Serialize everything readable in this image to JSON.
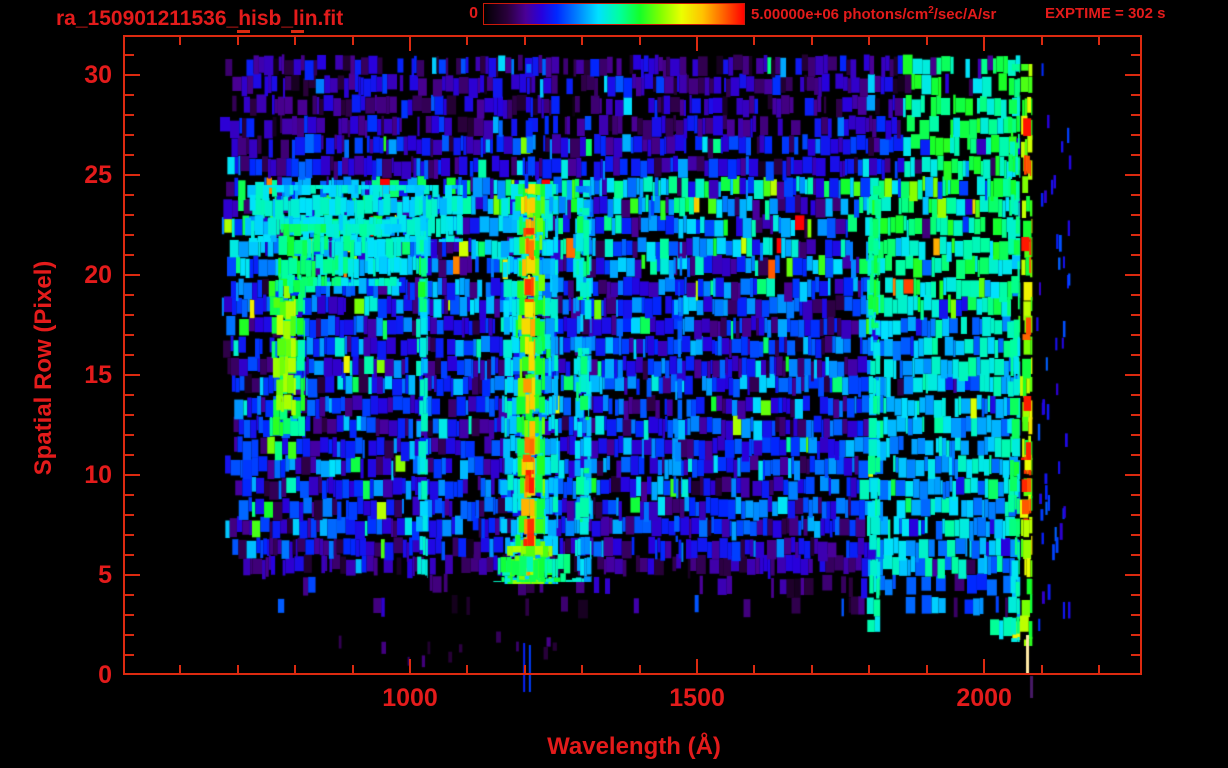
{
  "header": {
    "title": "ra_150901211536_hisb_lin.fit",
    "colorbar": {
      "min_label": "0",
      "max_prefix": "5.00000e+06 photons/cm",
      "max_sup": "2",
      "max_suffix": "/sec/A/sr"
    },
    "exptime": "EXPTIME = 302 s"
  },
  "colors": {
    "background": "#000000",
    "text": "#e31b1b",
    "axis": "#dc2a10",
    "colorbar_border": "#cc1a08"
  },
  "axes": {
    "x_title": "Wavelength (Å)",
    "y_title": "Spatial Row (Pixel)",
    "x_major_ticks": [
      {
        "value": 1000,
        "label": "1000"
      },
      {
        "value": 1500,
        "label": "1500"
      },
      {
        "value": 2000,
        "label": "2000"
      }
    ],
    "x_minor_step": 100,
    "x_minor_range": [
      600,
      2200
    ],
    "y_major_ticks": [
      {
        "value": 0,
        "label": "0"
      },
      {
        "value": 5,
        "label": "5"
      },
      {
        "value": 10,
        "label": "10"
      },
      {
        "value": 15,
        "label": "15"
      },
      {
        "value": 20,
        "label": "20"
      },
      {
        "value": 25,
        "label": "25"
      },
      {
        "value": 30,
        "label": "30"
      }
    ],
    "y_minor_step": 1
  },
  "chart_data": {
    "type": "heatmap",
    "title": "ra_150901211536_hisb_lin.fit",
    "xlabel": "Wavelength (Å)",
    "ylabel": "Spatial Row (Pixel)",
    "xlim": [
      500,
      2275
    ],
    "ylim": [
      0,
      32
    ],
    "colorbar_range": [
      0,
      5000000
    ],
    "colorbar_units": "photons/cm2/sec/A/sr",
    "exposure_s": 302,
    "colormap_stops": [
      [
        0.0,
        0,
        0,
        0
      ],
      [
        0.09,
        42,
        0,
        60
      ],
      [
        0.16,
        74,
        0,
        150
      ],
      [
        0.22,
        40,
        0,
        220
      ],
      [
        0.28,
        0,
        40,
        255
      ],
      [
        0.36,
        0,
        130,
        255
      ],
      [
        0.44,
        0,
        225,
        255
      ],
      [
        0.52,
        0,
        255,
        160
      ],
      [
        0.6,
        20,
        255,
        40
      ],
      [
        0.68,
        130,
        255,
        0
      ],
      [
        0.76,
        235,
        255,
        0
      ],
      [
        0.84,
        255,
        195,
        0
      ],
      [
        0.92,
        255,
        100,
        0
      ],
      [
        1.0,
        255,
        0,
        0
      ]
    ],
    "noise": {
      "seed": 150901211,
      "row_bands": [
        {
          "rows": [
            2,
            2
          ],
          "mean": 0.48,
          "density": 0.8,
          "wl": [
            1988,
            2063
          ]
        },
        {
          "rows": [
            3,
            3
          ],
          "mean": 0.13,
          "density": 0.5,
          "wl": [
            740,
            2063
          ],
          "dense_from": 1770
        },
        {
          "rows": [
            4,
            4
          ],
          "mean": 0.15,
          "density": 0.6,
          "wl": [
            700,
            2063
          ],
          "dense_from": 1640
        },
        {
          "rows": [
            5,
            5
          ],
          "mean": 0.16,
          "density": 0.85,
          "wl": [
            700,
            2063
          ]
        },
        {
          "rows": [
            6,
            6
          ],
          "mean": 0.23,
          "density": 0.92,
          "wl": [
            678,
            2063
          ]
        },
        {
          "rows": [
            7,
            9
          ],
          "mean": 0.27,
          "density": 0.95,
          "wl": [
            678,
            2063
          ]
        },
        {
          "rows": [
            10,
            17
          ],
          "mean": 0.28,
          "density": 0.95,
          "wl": [
            672,
            2063
          ]
        },
        {
          "rows": [
            18,
            19
          ],
          "mean": 0.31,
          "density": 0.95,
          "wl": [
            672,
            2063
          ]
        },
        {
          "rows": [
            20,
            21
          ],
          "mean": 0.38,
          "density": 0.95,
          "wl": [
            672,
            2063
          ]
        },
        {
          "rows": [
            22,
            24
          ],
          "mean": 0.4,
          "density": 0.95,
          "wl": [
            668,
            2063
          ]
        },
        {
          "rows": [
            25,
            26
          ],
          "mean": 0.24,
          "density": 0.9,
          "wl": [
            668,
            2063
          ]
        },
        {
          "rows": [
            27,
            30
          ],
          "mean": 0.18,
          "density": 0.84,
          "wl": [
            668,
            2063
          ]
        }
      ],
      "right_region": {
        "wl": [
          1758,
          2063
        ],
        "upper_from": 1850,
        "v_bright": [
          0.44,
          0.62
        ],
        "v_mid": [
          0.32,
          0.52
        ],
        "v_low": [
          0.27,
          0.43
        ]
      }
    },
    "features": [
      {
        "name": "continuum-top-band",
        "wl": [
          712,
          1092
        ],
        "rows": [
          21.8,
          24.35
        ],
        "v": [
          0.4,
          0.5
        ]
      },
      {
        "name": "aperture-hook-blob",
        "wl": [
          770,
          985
        ],
        "rows": [
          19.6,
          22.4
        ],
        "v": [
          0.5,
          0.62
        ],
        "fade": 1
      },
      {
        "name": "aperture-hook-strip",
        "wl": [
          753,
          817
        ],
        "rows": [
          12.1,
          19.6
        ],
        "v": [
          0.5,
          0.62
        ]
      },
      {
        "name": "aperture-hook-core",
        "wl": [
          760,
          801
        ],
        "rows": [
          13.0,
          18.7
        ],
        "v": [
          0.64,
          0.74
        ]
      },
      {
        "name": "lyman-beta-line",
        "wl": [
          1010,
          1031
        ],
        "rows": [
          5.0,
          24.3
        ],
        "v": [
          0.4,
          0.5
        ]
      },
      {
        "name": "lyman-beta-bright",
        "wl": [
          1012,
          1029
        ],
        "rows": [
          18.3,
          21.6
        ],
        "v": [
          0.52,
          0.62
        ]
      },
      {
        "name": "lyman-alpha-outer",
        "wl": [
          1157,
          1258
        ],
        "rows": [
          4.7,
          24.4
        ],
        "v": [
          0.38,
          0.5
        ]
      },
      {
        "name": "lyman-alpha-mid",
        "wl": [
          1183,
          1235
        ],
        "rows": [
          4.7,
          24.4
        ],
        "v": [
          0.55,
          0.68
        ]
      },
      {
        "name": "lyman-alpha-core",
        "wl": [
          1193,
          1218
        ],
        "rows": [
          4.7,
          24.4
        ],
        "v": [
          0.78,
          0.88
        ]
      },
      {
        "name": "lyman-alpha-red-1",
        "wl": [
          1196,
          1216
        ],
        "rows": [
          6.4,
          7.7
        ],
        "v": [
          0.9,
          0.98
        ]
      },
      {
        "name": "lyman-alpha-red-2",
        "wl": [
          1196,
          1216
        ],
        "rows": [
          9.2,
          10.1
        ],
        "v": [
          0.9,
          0.98
        ]
      },
      {
        "name": "lyman-alpha-red-3",
        "wl": [
          1196,
          1216
        ],
        "rows": [
          10.8,
          11.9
        ],
        "v": [
          0.9,
          0.98
        ]
      },
      {
        "name": "lyman-alpha-red-4",
        "wl": [
          1196,
          1216
        ],
        "rows": [
          18.8,
          19.9
        ],
        "v": [
          0.9,
          0.98
        ]
      },
      {
        "name": "lyman-alpha-red-5",
        "wl": [
          1196,
          1216
        ],
        "rows": [
          20.9,
          22.2
        ],
        "v": [
          0.9,
          0.98
        ]
      },
      {
        "name": "lyman-alpha-base-flare",
        "wl": [
          1168,
          1248
        ],
        "rows": [
          4.7,
          6.3
        ],
        "v": [
          0.58,
          0.72
        ]
      },
      {
        "name": "lyman-alpha-base-wing",
        "wl": [
          1140,
          1290
        ],
        "rows": [
          4.8,
          5.9
        ],
        "v": [
          0.48,
          0.6
        ]
      },
      {
        "name": "lyman-alpha-top-bleed",
        "wl": [
          1196,
          1214
        ],
        "rows": [
          24.4,
          30.4
        ],
        "v": [
          0.22,
          0.36
        ],
        "density": 0.5
      },
      {
        "name": "oi-1300-strip",
        "wl": [
          1284,
          1316
        ],
        "rows": [
          4.8,
          24.3
        ],
        "v": [
          0.36,
          0.48
        ]
      },
      {
        "name": "oi-1300-seg-1",
        "wl": [
          1288,
          1312
        ],
        "rows": [
          7.8,
          10.2
        ],
        "v": [
          0.45,
          0.58
        ]
      },
      {
        "name": "oi-1300-seg-2",
        "wl": [
          1288,
          1312
        ],
        "rows": [
          12.9,
          16.2
        ],
        "v": [
          0.45,
          0.58
        ]
      },
      {
        "name": "oi-1300-seg-3",
        "wl": [
          1288,
          1312
        ],
        "rows": [
          18.9,
          23.2
        ],
        "v": [
          0.45,
          0.58
        ]
      },
      {
        "name": "line-1465",
        "wl": [
          1458,
          1474
        ],
        "rows": [
          6.8,
          21.5
        ],
        "v": [
          0.3,
          0.4
        ],
        "density": 0.7
      },
      {
        "name": "line-1800",
        "wl": [
          1794,
          1819
        ],
        "rows": [
          2.3,
          24.3
        ],
        "v": [
          0.44,
          0.54
        ]
      },
      {
        "name": "line-1800-bright",
        "wl": [
          1797,
          1816
        ],
        "rows": [
          17.5,
          23.6
        ],
        "v": [
          0.52,
          0.62
        ]
      },
      {
        "name": "red-edge-inner-green",
        "wl": [
          2040,
          2062
        ],
        "rows": [
          1.8,
          30.4
        ],
        "v": [
          0.45,
          0.6
        ]
      },
      {
        "name": "red-edge-column",
        "wl": [
          2062,
          2084
        ],
        "rows": [
          1.6,
          30.4
        ],
        "v": [
          0.58,
          0.8
        ]
      },
      {
        "name": "red-edge-hot-1",
        "wl": [
          2064,
          2082
        ],
        "rows": [
          7.9,
          8.7
        ],
        "v": [
          0.92,
          0.99
        ]
      },
      {
        "name": "red-edge-hot-2",
        "wl": [
          2064,
          2082
        ],
        "rows": [
          9.3,
          10.1
        ],
        "v": [
          0.92,
          0.99
        ]
      },
      {
        "name": "red-edge-hot-3",
        "wl": [
          2064,
          2082
        ],
        "rows": [
          10.9,
          11.7
        ],
        "v": [
          0.92,
          0.99
        ]
      },
      {
        "name": "red-edge-hot-4",
        "wl": [
          2064,
          2082
        ],
        "rows": [
          13.1,
          13.8
        ],
        "v": [
          0.92,
          0.99
        ]
      },
      {
        "name": "red-edge-hot-5",
        "wl": [
          2064,
          2082
        ],
        "rows": [
          16.9,
          17.8
        ],
        "v": [
          0.92,
          0.99
        ]
      },
      {
        "name": "red-edge-hot-6",
        "wl": [
          2064,
          2082
        ],
        "rows": [
          20.0,
          20.9
        ],
        "v": [
          0.92,
          0.99
        ]
      },
      {
        "name": "red-edge-hot-7",
        "wl": [
          2064,
          2082
        ],
        "rows": [
          21.1,
          21.9
        ],
        "v": [
          0.92,
          0.99
        ]
      },
      {
        "name": "red-edge-hot-8",
        "wl": [
          2064,
          2082
        ],
        "rows": [
          25.1,
          25.9
        ],
        "v": [
          0.92,
          0.99
        ]
      },
      {
        "name": "red-edge-hot-9",
        "wl": [
          2064,
          2082
        ],
        "rows": [
          27.1,
          27.9
        ],
        "v": [
          0.92,
          0.99
        ]
      }
    ],
    "specks": [
      {
        "name": "overscan-strays",
        "wl": [
          2090,
          2150
        ],
        "rows": [
          2,
          30.5
        ],
        "count": 48,
        "w": [
          2,
          3
        ],
        "h": [
          10,
          17
        ],
        "v": [
          0.2,
          0.33
        ]
      },
      {
        "name": "bottom-strays",
        "wl": [
          780,
          1270
        ],
        "rows": [
          0.3,
          1.9
        ],
        "count": 12,
        "w": [
          2,
          5
        ],
        "h": [
          8,
          14
        ],
        "v": [
          0.07,
          0.15
        ]
      }
    ],
    "overlays": [
      {
        "name": "lya-bleed-line-1",
        "wl": 1197,
        "y": [
          608,
          657
        ],
        "w": 2,
        "v": 0.27
      },
      {
        "name": "lya-bleed-line-2",
        "wl": 1207,
        "y": [
          610,
          657
        ],
        "w": 2,
        "v": 0.3
      },
      {
        "name": "edge-bleed-bright",
        "wl": 2073,
        "y": [
          600,
          639
        ],
        "w": 3,
        "color": "#ffe9a6"
      },
      {
        "name": "edge-bleed-dark",
        "wl": 2080,
        "y": [
          641,
          663
        ],
        "w": 3,
        "color": "#471a66"
      }
    ],
    "artifacts": [
      {
        "x": 237,
        "y": 30,
        "w": 13,
        "h": 3
      },
      {
        "x": 291,
        "y": 30,
        "w": 13,
        "h": 3
      }
    ]
  }
}
